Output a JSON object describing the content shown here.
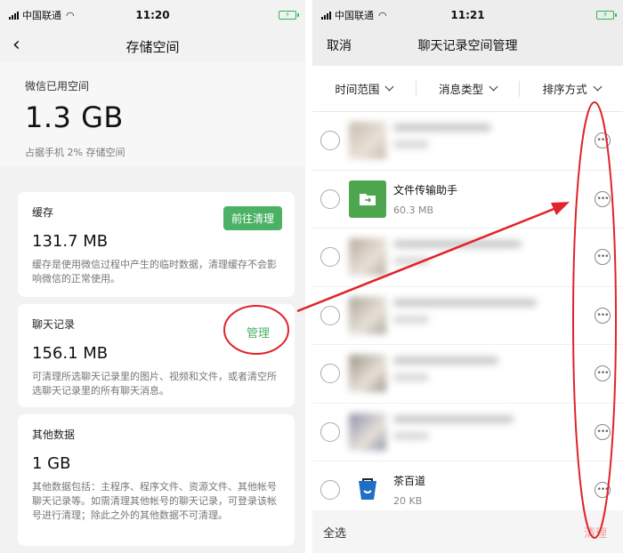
{
  "left": {
    "status": {
      "carrier": "中国联通",
      "time": "11:20"
    },
    "nav": {
      "title": "存储空间"
    },
    "summary": {
      "label": "微信已用空间",
      "size": "1.3 GB",
      "sub": "占据手机 2% 存储空间"
    },
    "cache": {
      "title": "缓存",
      "size": "131.7 MB",
      "button": "前往清理",
      "desc": "缓存是使用微信过程中产生的临时数据，清理缓存不会影响微信的正常使用。"
    },
    "chat": {
      "title": "聊天记录",
      "size": "156.1 MB",
      "button": "管理",
      "desc": "可清理所选聊天记录里的图片、视频和文件，或者清空所选聊天记录里的所有聊天消息。"
    },
    "other": {
      "title": "其他数据",
      "size": "1 GB",
      "desc": "其他数据包括：主程序、程序文件、资源文件、其他帐号聊天记录等。如需清理其他帐号的聊天记录，可登录该帐号进行清理；除此之外的其他数据不可清理。"
    }
  },
  "right": {
    "status": {
      "carrier": "中国联通",
      "time": "11:21"
    },
    "nav": {
      "cancel": "取消",
      "title": "聊天记录空间管理"
    },
    "filters": [
      "时间范围",
      "消息类型",
      "排序方式"
    ],
    "rows": [
      {
        "name": "",
        "size": "",
        "blurred": true,
        "thumb_color": "#c7b9a6"
      },
      {
        "name": "文件传输助手",
        "size": "60.3 MB",
        "blurred": false,
        "thumb": "folder-icon",
        "thumb_color": "#4ea74f"
      },
      {
        "name": "",
        "size": "",
        "blurred": true,
        "thumb_color": "#b8a89a"
      },
      {
        "name": "",
        "size": "",
        "blurred": true,
        "thumb_color": "#a9a396"
      },
      {
        "name": "",
        "size": "",
        "blurred": true,
        "thumb_color": "#9b9284"
      },
      {
        "name": "",
        "size": "",
        "blurred": true,
        "thumb_color": "#8b8fa8"
      },
      {
        "name": "茶百道",
        "size": "20 KB",
        "blurred": false,
        "thumb": "cup-icon",
        "thumb_color": "#1f6ec4"
      }
    ],
    "bottom": {
      "select_all": "全选",
      "clean": "清理"
    }
  },
  "annotation_color": "#e0242b",
  "accent_green": "#4bb265"
}
